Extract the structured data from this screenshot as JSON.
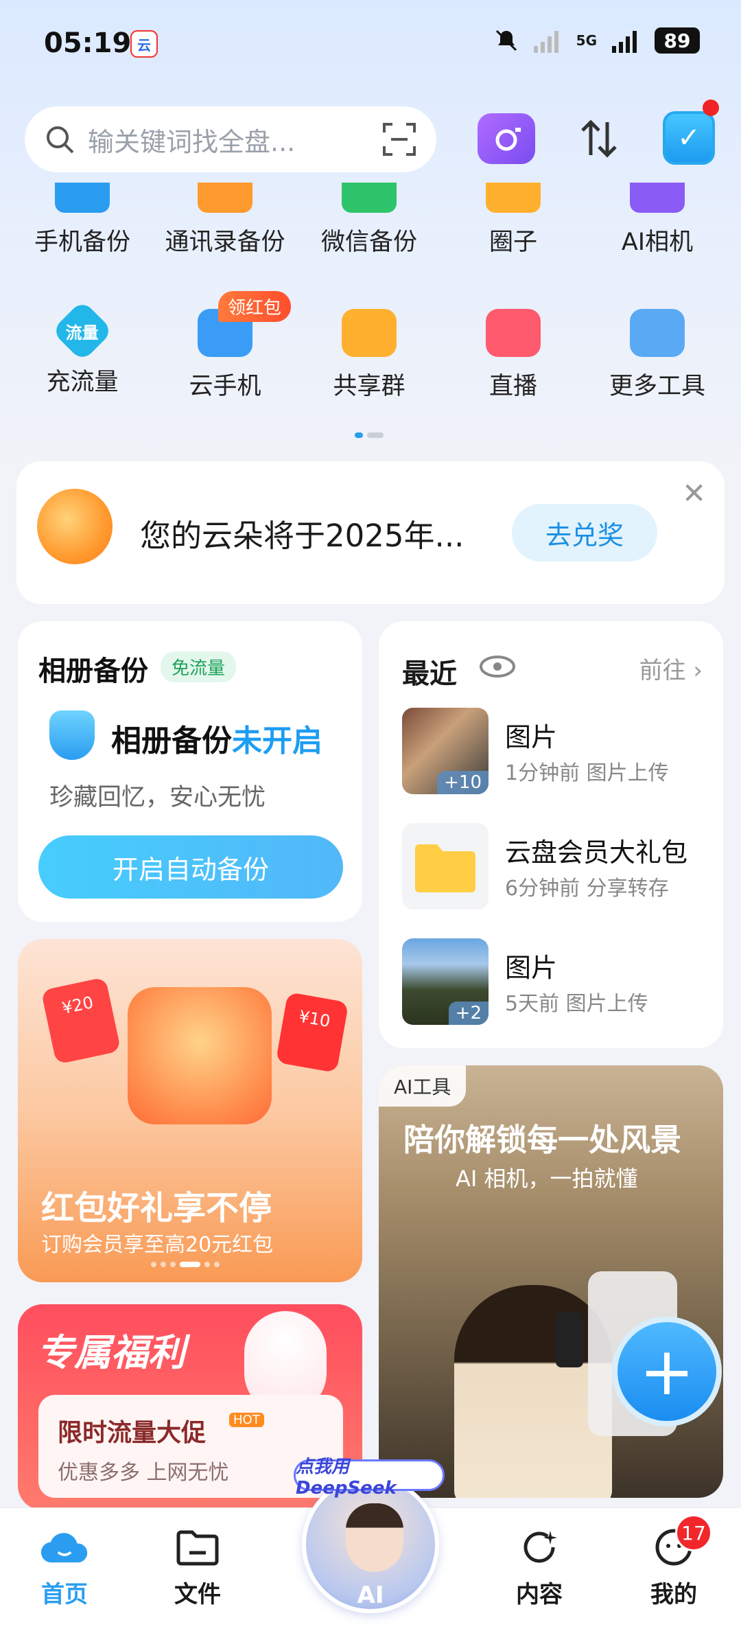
{
  "status_bar": {
    "time": "05:19",
    "app_icon": "云",
    "battery": "89",
    "network": "5G"
  },
  "search": {
    "placeholder": "输关键词找全盘..."
  },
  "grid_row1": [
    {
      "label": "手机备份",
      "icon": "phone-backup-icon",
      "color": "#2a9df0"
    },
    {
      "label": "通讯录备份",
      "icon": "contacts-backup-icon",
      "color": "#ff9a2e"
    },
    {
      "label": "微信备份",
      "icon": "wechat-backup-icon",
      "color": "#2ec46b"
    },
    {
      "label": "圈子",
      "icon": "circle-icon",
      "color": "#ffb02e"
    },
    {
      "label": "AI相机",
      "icon": "ai-camera-icon",
      "color": "#8a5cf5"
    }
  ],
  "grid_row2": [
    {
      "label": "充流量",
      "icon": "data-recharge-icon",
      "color": "#22b7e8",
      "text": "流量"
    },
    {
      "label": "云手机",
      "icon": "cloud-phone-icon",
      "color": "#3a9cf5"
    },
    {
      "label": "共享群",
      "icon": "share-group-icon",
      "color": "#ffb02e"
    },
    {
      "label": "直播",
      "icon": "live-icon",
      "color": "#ff5a6e"
    },
    {
      "label": "更多工具",
      "icon": "more-tools-icon",
      "color": "#5aa9f5"
    }
  ],
  "red_packet_badge": "领红包",
  "banner": {
    "text": "您的云朵将于2025年...",
    "button": "去兑奖"
  },
  "backup_card": {
    "title": "相册备份",
    "tag": "免流量",
    "status_prefix": "相册备份",
    "status_accent": "未开启",
    "desc": "珍藏回忆，安心无忧",
    "button": "开启自动备份"
  },
  "recent_card": {
    "title": "最近",
    "link": "前往",
    "items": [
      {
        "name": "图片",
        "meta": "1分钟前  图片上传",
        "badge": "+10"
      },
      {
        "name": "云盘会员大礼包",
        "meta": "6分钟前  分享转存",
        "badge": ""
      },
      {
        "name": "图片",
        "meta": "5天前  图片上传",
        "badge": "+2"
      }
    ]
  },
  "promo_card": {
    "title": "红包好礼享不停",
    "subtitle": "订购会员享至高20元红包",
    "env1": "¥20",
    "env2": "¥10"
  },
  "ai_card": {
    "tag": "AI工具",
    "title": "陪你解锁每一处风景",
    "subtitle": "AI 相机，一拍就懂"
  },
  "welfare_card": {
    "title": "专属福利",
    "headline": "限时流量大促",
    "hot": "HOT",
    "subtitle": "优惠多多 上网无忧"
  },
  "fab": {
    "label": "+"
  },
  "nav": {
    "home": "首页",
    "files": "文件",
    "ai": "AI",
    "ai_promo": "点我用DeepSeek",
    "content": "内容",
    "mine": "我的",
    "mine_badge": "17"
  }
}
